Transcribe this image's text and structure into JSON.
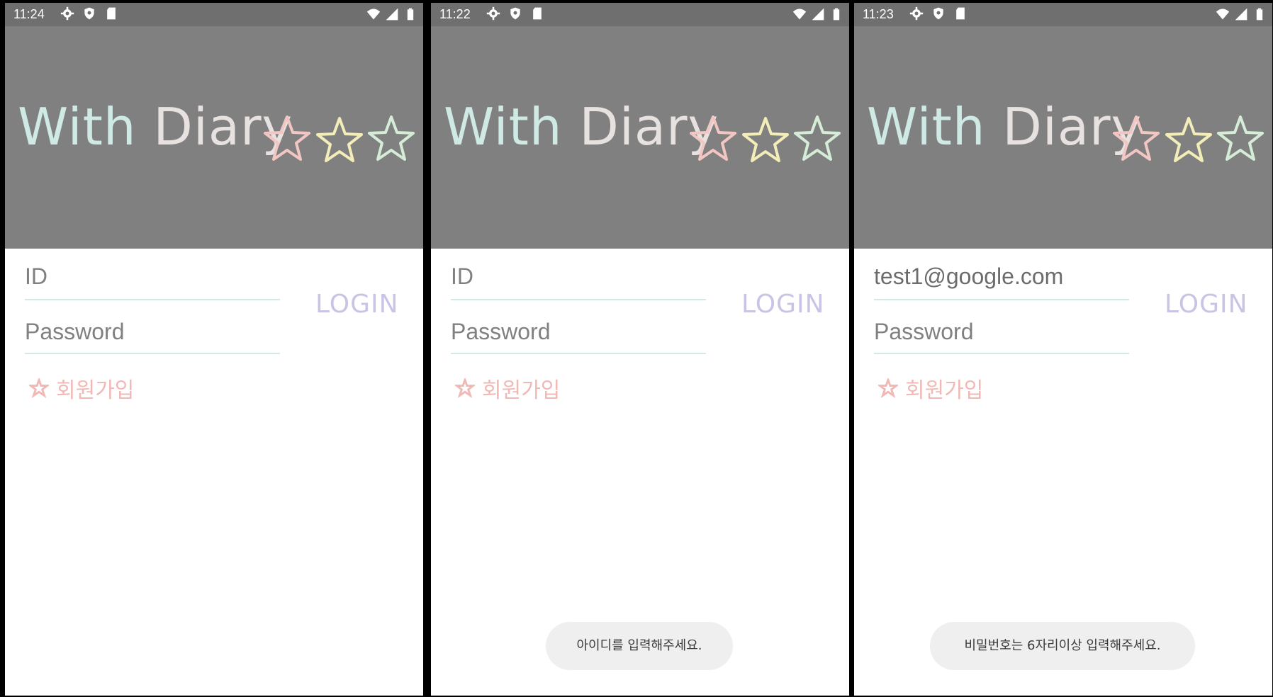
{
  "app": {
    "title_part1": "With",
    "title_part2": "Diary"
  },
  "screens": [
    {
      "time": "11:24",
      "id_text": "ID",
      "password_text": "Password",
      "login_label": "LOGIN",
      "signup_label": "회원가입",
      "toast": ""
    },
    {
      "time": "11:22",
      "id_text": "ID",
      "password_text": "Password",
      "login_label": "LOGIN",
      "signup_label": "회원가입",
      "toast": "아이디를 입력해주세요."
    },
    {
      "time": "11:23",
      "id_text": "test1@google.com",
      "password_text": "Password",
      "login_label": "LOGIN",
      "signup_label": "회원가입",
      "toast": "비밀번호는 6자리이상 입력해주세요."
    }
  ],
  "colors": {
    "header_bg": "#808080",
    "status_bg": "#6f6f6f",
    "title_with": "#cfe9e4",
    "title_diary": "#e7e1e0",
    "star_pink": "#f2c7c3",
    "star_yellow": "#f3eeb9",
    "star_green": "#d5edd7",
    "login": "#c8c4e6",
    "signup": "#f0b9b6",
    "field_line": "#cfe9e4"
  },
  "icons": [
    "settings-icon",
    "shield-icon",
    "sd-card-icon",
    "wifi-icon",
    "signal-icon",
    "battery-icon",
    "star-icon"
  ]
}
